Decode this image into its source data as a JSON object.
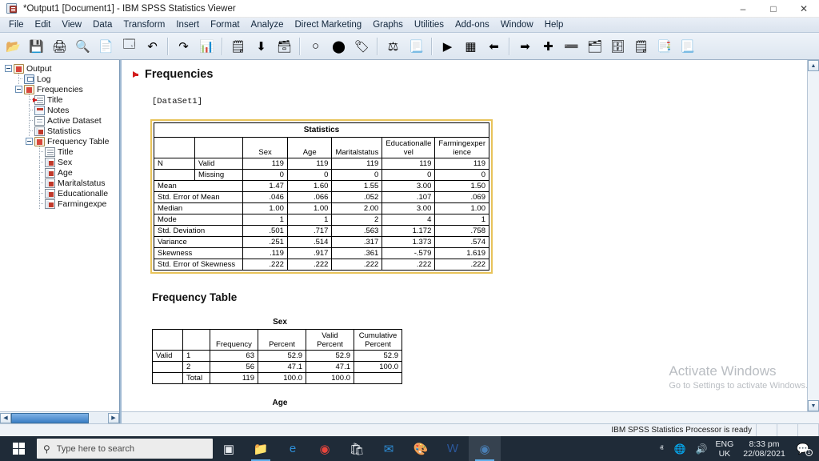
{
  "window": {
    "title": "*Output1 [Document1] - IBM SPSS Statistics Viewer",
    "app_icon": "spss-viewer-icon",
    "minimize": "–",
    "maximize": "□",
    "close": "✕"
  },
  "menubar": [
    {
      "label": "File",
      "accel": "F"
    },
    {
      "label": "Edit",
      "accel": "E"
    },
    {
      "label": "View",
      "accel": "V"
    },
    {
      "label": "Data",
      "accel": "D"
    },
    {
      "label": "Transform",
      "accel": "T"
    },
    {
      "label": "Insert",
      "accel": "I"
    },
    {
      "label": "Format",
      "accel": "o"
    },
    {
      "label": "Analyze",
      "accel": "A"
    },
    {
      "label": "Direct Marketing",
      "accel": "M"
    },
    {
      "label": "Graphs",
      "accel": "G"
    },
    {
      "label": "Utilities",
      "accel": "U"
    },
    {
      "label": "Add-ons",
      "accel": "n"
    },
    {
      "label": "Window",
      "accel": "W"
    },
    {
      "label": "Help",
      "accel": "H"
    }
  ],
  "toolbar": [
    {
      "name": "open-file-button",
      "glyph": "📂"
    },
    {
      "name": "save-button",
      "glyph": "💾"
    },
    {
      "name": "print-button",
      "glyph": "🖨"
    },
    {
      "name": "print-preview-button",
      "glyph": "🔍"
    },
    {
      "name": "export-button",
      "glyph": "📄"
    },
    {
      "name": "recall-dialog-button",
      "glyph": "🗔"
    },
    {
      "name": "undo-button",
      "glyph": "↶"
    },
    {
      "name": "redo-button",
      "glyph": "↷"
    },
    {
      "name": "goto-data-button",
      "glyph": "📊"
    },
    {
      "name": "goto-case-button",
      "glyph": "🗒"
    },
    {
      "name": "insert-cases-button",
      "glyph": "⬇"
    },
    {
      "name": "variables-button",
      "glyph": "🗃"
    },
    {
      "name": "select-cases-button",
      "glyph": "○"
    },
    {
      "name": "value-labels-button",
      "glyph": "⬤"
    },
    {
      "name": "split-file-button",
      "glyph": "🏷"
    },
    {
      "name": "weight-cases-button",
      "glyph": "⚖"
    },
    {
      "name": "find-button",
      "glyph": "📃"
    },
    {
      "name": "run-button",
      "glyph": "▶"
    },
    {
      "name": "grid-button",
      "glyph": "▦"
    },
    {
      "name": "back-button",
      "glyph": "⬅"
    },
    {
      "name": "forward-button",
      "glyph": "➡"
    },
    {
      "name": "promote-button",
      "glyph": "✚"
    },
    {
      "name": "demote-button",
      "glyph": "➖"
    },
    {
      "name": "show-button",
      "glyph": "🗂"
    },
    {
      "name": "hide-button",
      "glyph": "🗄"
    },
    {
      "name": "insert-heading-button",
      "glyph": "🗒"
    },
    {
      "name": "insert-title-button",
      "glyph": "📑"
    },
    {
      "name": "insert-text-button",
      "glyph": "📃"
    }
  ],
  "outline": {
    "nodes": [
      {
        "label": "Output",
        "level": 0,
        "icon": "output-book-icon",
        "expander": "minus",
        "marker": false
      },
      {
        "label": "Log",
        "level": 1,
        "icon": "log-icon",
        "expander": "none",
        "marker": false
      },
      {
        "label": "Frequencies",
        "level": 1,
        "icon": "output-book-icon",
        "expander": "minus",
        "marker": false
      },
      {
        "label": "Title",
        "level": 2,
        "icon": "title-icon",
        "expander": "none",
        "marker": true
      },
      {
        "label": "Notes",
        "level": 2,
        "icon": "notes-icon",
        "expander": "none",
        "marker": false
      },
      {
        "label": "Active Dataset",
        "level": 2,
        "icon": "page-icon",
        "expander": "none",
        "marker": false
      },
      {
        "label": "Statistics",
        "level": 2,
        "icon": "table-icon",
        "expander": "none",
        "marker": false
      },
      {
        "label": "Frequency Table",
        "level": 2,
        "icon": "output-book-icon",
        "expander": "minus",
        "marker": false
      },
      {
        "label": "Title",
        "level": 3,
        "icon": "title-icon",
        "expander": "none",
        "marker": false
      },
      {
        "label": "Sex",
        "level": 3,
        "icon": "table-icon",
        "expander": "none",
        "marker": false
      },
      {
        "label": "Age",
        "level": 3,
        "icon": "table-icon",
        "expander": "none",
        "marker": false
      },
      {
        "label": "Maritalstatus",
        "level": 3,
        "icon": "table-icon",
        "expander": "none",
        "marker": false
      },
      {
        "label": "Educationalle",
        "level": 3,
        "icon": "table-icon",
        "expander": "none",
        "marker": false
      },
      {
        "label": "Farmingexpe",
        "level": 3,
        "icon": "table-icon",
        "expander": "none",
        "marker": false
      }
    ]
  },
  "viewer": {
    "heading": "Frequencies",
    "dataset_label": "[DataSet1]",
    "frequency_table_heading": "Frequency Table"
  },
  "statistics_table": {
    "caption": "Statistics",
    "columns": [
      "Sex",
      "Age",
      "Maritalstatus",
      "Educationallevel",
      "Farmingexperience"
    ],
    "column_display": [
      "Sex",
      "Age",
      "Maritalstatus",
      "Educationalle vel",
      "Farmingexper ience"
    ],
    "rows": [
      {
        "label": "N",
        "sublabel": "Valid",
        "values": [
          "119",
          "119",
          "119",
          "119",
          "119"
        ]
      },
      {
        "label": "",
        "sublabel": "Missing",
        "values": [
          "0",
          "0",
          "0",
          "0",
          "0"
        ]
      },
      {
        "label": "Mean",
        "sublabel": "",
        "values": [
          "1.47",
          "1.60",
          "1.55",
          "3.00",
          "1.50"
        ]
      },
      {
        "label": "Std. Error of Mean",
        "sublabel": "",
        "values": [
          ".046",
          ".066",
          ".052",
          ".107",
          ".069"
        ]
      },
      {
        "label": "Median",
        "sublabel": "",
        "values": [
          "1.00",
          "1.00",
          "2.00",
          "3.00",
          "1.00"
        ]
      },
      {
        "label": "Mode",
        "sublabel": "",
        "values": [
          "1",
          "1",
          "2",
          "4",
          "1"
        ]
      },
      {
        "label": "Std. Deviation",
        "sublabel": "",
        "values": [
          ".501",
          ".717",
          ".563",
          "1.172",
          ".758"
        ]
      },
      {
        "label": "Variance",
        "sublabel": "",
        "values": [
          ".251",
          ".514",
          ".317",
          "1.373",
          ".574"
        ]
      },
      {
        "label": "Skewness",
        "sublabel": "",
        "values": [
          ".119",
          ".917",
          ".361",
          "-.579",
          "1.619"
        ]
      },
      {
        "label": "Std. Error of Skewness",
        "sublabel": "",
        "values": [
          ".222",
          ".222",
          ".222",
          ".222",
          ".222"
        ]
      }
    ]
  },
  "sex_table": {
    "caption": "Sex",
    "columns": [
      "Frequency",
      "Percent",
      "Valid Percent",
      "Cumulative Percent"
    ],
    "rows": [
      {
        "group": "Valid",
        "category": "1",
        "values": [
          "63",
          "52.9",
          "52.9",
          "52.9"
        ]
      },
      {
        "group": "",
        "category": "2",
        "values": [
          "56",
          "47.1",
          "47.1",
          "100.0"
        ]
      },
      {
        "group": "",
        "category": "Total",
        "values": [
          "119",
          "100.0",
          "100.0",
          ""
        ]
      }
    ]
  },
  "age_table": {
    "caption": "Age"
  },
  "watermark": {
    "line1": "Activate Windows",
    "line2": "Go to Settings to activate Windows."
  },
  "statusbar": {
    "message": "IBM SPSS Statistics Processor is ready"
  },
  "taskbar": {
    "start": "start-button",
    "search_placeholder": "Type here to search",
    "items": [
      {
        "name": "task-view-button",
        "glyph": "▣"
      },
      {
        "name": "file-explorer-button",
        "glyph": "📁"
      },
      {
        "name": "edge-button",
        "glyph": "e"
      },
      {
        "name": "chrome-button",
        "glyph": "◉"
      },
      {
        "name": "microsoft-store-button",
        "glyph": "🛍"
      },
      {
        "name": "mail-button",
        "glyph": "✉"
      },
      {
        "name": "paint-button",
        "glyph": "🎨"
      },
      {
        "name": "word-button",
        "glyph": "W"
      },
      {
        "name": "spss-button",
        "glyph": "◉"
      }
    ],
    "tray": {
      "chevron": "ⱏ",
      "network": "🌐",
      "volume": "🔊",
      "lang_line1": "ENG",
      "lang_line2": "UK",
      "time": "8:33 pm",
      "date": "22/08/2021",
      "notifications": "🗪",
      "notification_count": "1"
    }
  }
}
